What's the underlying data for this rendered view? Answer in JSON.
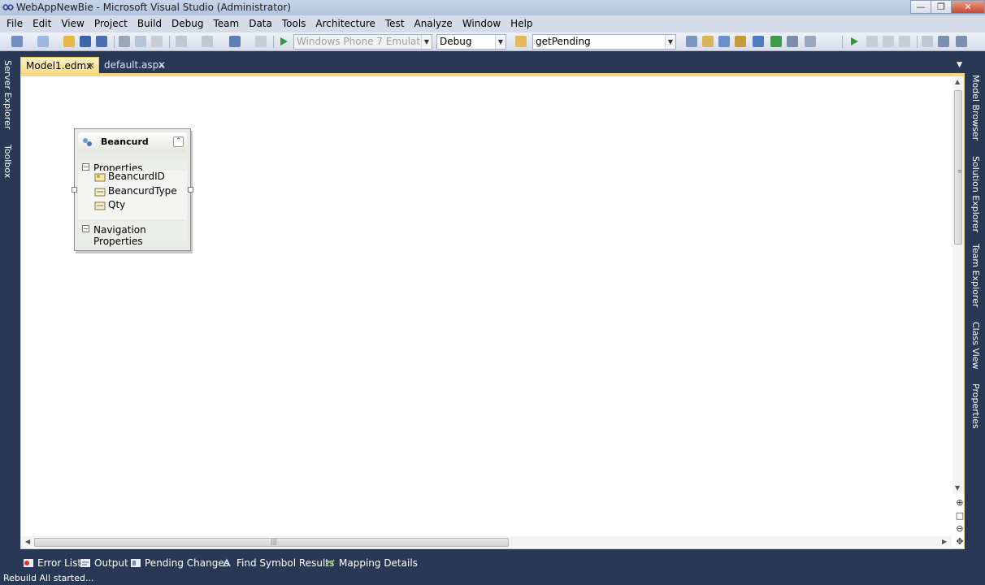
{
  "window": {
    "title": "WebAppNewBie - Microsoft Visual Studio (Administrator)",
    "minimize_icon": "minimize-icon",
    "maximize_icon": "restore-icon",
    "close_icon": "close-icon"
  },
  "menu": [
    "File",
    "Edit",
    "View",
    "Project",
    "Build",
    "Debug",
    "Team",
    "Data",
    "Tools",
    "Architecture",
    "Test",
    "Analyze",
    "Window",
    "Help"
  ],
  "toolbar": {
    "target_device": "Windows Phone 7 Emulator",
    "configuration": "Debug",
    "find_value": "getPending"
  },
  "left_panels": [
    "Server Explorer",
    "Toolbox"
  ],
  "right_panels": [
    "Model Browser",
    "Solution Explorer",
    "Team Explorer",
    "Class View",
    "Properties"
  ],
  "tabs": [
    {
      "label": "Model1.edmx",
      "active": true
    },
    {
      "label": "default.aspx",
      "active": false
    }
  ],
  "entity": {
    "name": "Beancurd",
    "properties_label": "Properties",
    "properties": [
      {
        "name": "BeancurdID",
        "icon": "key-property-icon"
      },
      {
        "name": "BeancurdType",
        "icon": "property-icon"
      },
      {
        "name": "Qty",
        "icon": "property-icon"
      }
    ],
    "navigation_label": "Navigation Properties"
  },
  "bottom_windows": [
    "Error List",
    "Output",
    "Pending Changes",
    "Find Symbol Results",
    "Mapping Details"
  ],
  "status": "Rebuild All started...",
  "colors": {
    "chrome": "#293955",
    "active_tab": "#f8dc85",
    "menubar": "#d6dbe9"
  }
}
